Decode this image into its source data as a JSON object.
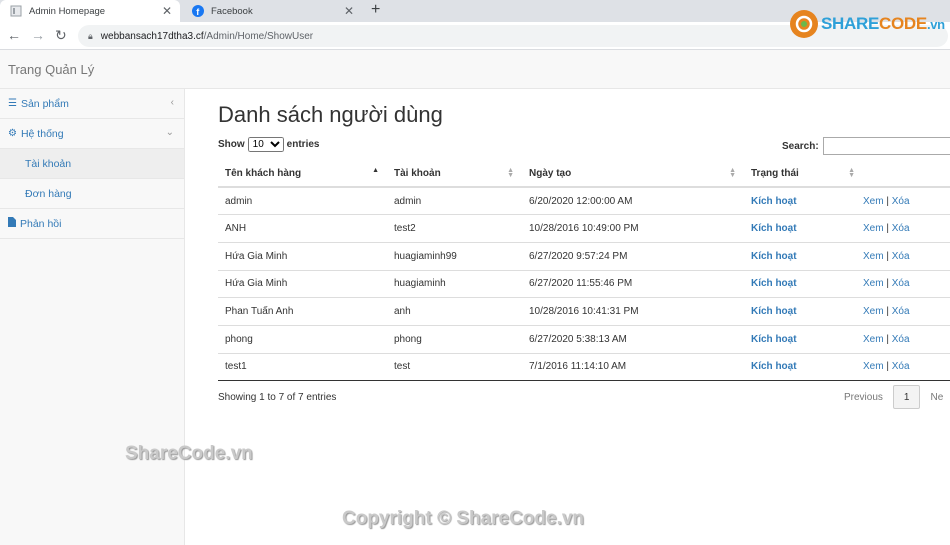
{
  "browser": {
    "tabs": [
      {
        "title": "Admin Homepage"
      },
      {
        "title": "Facebook"
      }
    ],
    "url_host": "webbansach17dtha3.cf",
    "url_path": "/Admin/Home/ShowUser"
  },
  "navbar": {
    "brand": "Trang Quản Lý"
  },
  "sidebar": {
    "items": [
      {
        "label": "Sản phẩm",
        "icon": "bars-icon"
      },
      {
        "label": "Hệ thống",
        "icon": "gears-icon"
      },
      {
        "label": "Tài khoản"
      },
      {
        "label": "Đơn hàng"
      },
      {
        "label": "Phản hồi",
        "icon": "file-icon"
      }
    ]
  },
  "main": {
    "title": "Danh sách người dùng",
    "length": {
      "show": "Show",
      "value": "10",
      "entries": "entries"
    },
    "search_label": "Search:",
    "columns": [
      "Tên khách hàng",
      "Tài khoản",
      "Ngày tạo",
      "Trạng thái"
    ],
    "rows": [
      {
        "name": "admin",
        "account": "admin",
        "created": "6/20/2020 12:00:00 AM",
        "status": "Kích hoạt"
      },
      {
        "name": "ANH",
        "account": "test2",
        "created": "10/28/2016 10:49:00 PM",
        "status": "Kích hoạt"
      },
      {
        "name": "Hứa Gia Minh",
        "account": "huagiaminh99",
        "created": "6/27/2020 9:57:24 PM",
        "status": "Kích hoạt"
      },
      {
        "name": "Hứa Gia Minh",
        "account": "huagiaminh",
        "created": "6/27/2020 11:55:46 PM",
        "status": "Kích hoạt"
      },
      {
        "name": "Phan Tuấn Anh",
        "account": "anh",
        "created": "10/28/2016 10:41:31 PM",
        "status": "Kích hoạt"
      },
      {
        "name": "phong",
        "account": "phong",
        "created": "6/27/2020 5:38:13 AM",
        "status": "Kích hoạt"
      },
      {
        "name": "test1",
        "account": "test",
        "created": "7/1/2016 11:14:10 AM",
        "status": "Kích hoạt"
      }
    ],
    "view_label": "Xem",
    "delete_label": "Xóa",
    "info": "Showing 1 to 7 of 7 entries",
    "pager": {
      "previous": "Previous",
      "current": "1",
      "next": "Ne"
    }
  },
  "watermarks": {
    "logo_text_a": "SHARE",
    "logo_text_b": "CODE",
    "logo_text_c": ".vn",
    "text1": "ShareCode.vn",
    "text2": "Copyright © ShareCode.vn"
  }
}
